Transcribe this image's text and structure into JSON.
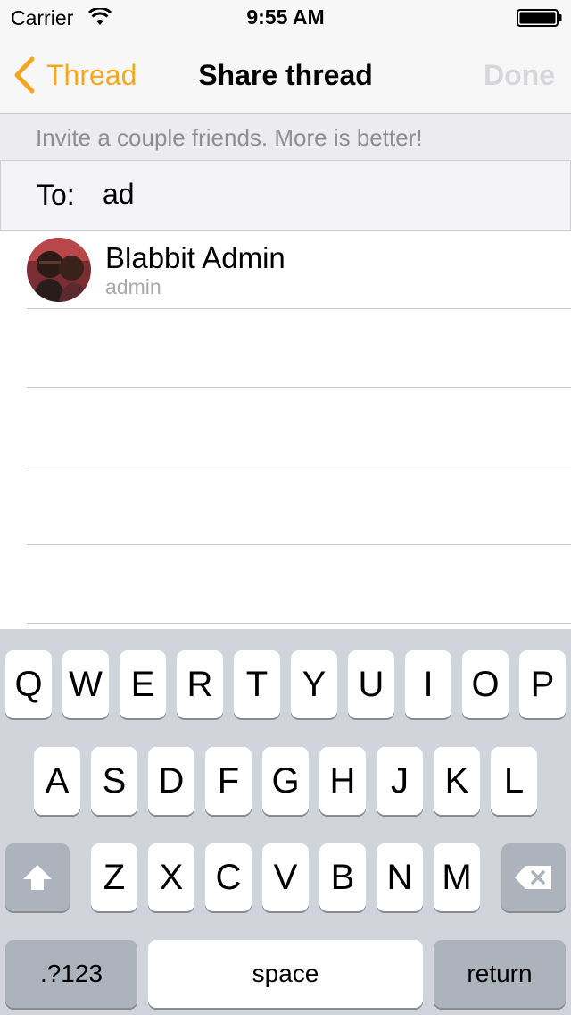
{
  "status_bar": {
    "carrier": "Carrier",
    "time": "9:55 AM",
    "wifi_icon": "wifi-icon",
    "battery_icon": "battery-icon"
  },
  "nav": {
    "back_label": "Thread",
    "back_icon": "chevron-left-icon",
    "title": "Share thread",
    "done_label": "Done",
    "accent_color": "#f5a623",
    "done_state": "disabled"
  },
  "hint": "Invite a couple friends. More is better!",
  "to_field": {
    "label": "To:",
    "value": "ad"
  },
  "results": [
    {
      "name": "Blabbit Admin",
      "username": "admin"
    }
  ],
  "keyboard": {
    "row1": [
      "Q",
      "W",
      "E",
      "R",
      "T",
      "Y",
      "U",
      "I",
      "O",
      "P"
    ],
    "row2": [
      "A",
      "S",
      "D",
      "F",
      "G",
      "H",
      "J",
      "K",
      "L"
    ],
    "row3": [
      "Z",
      "X",
      "C",
      "V",
      "B",
      "N",
      "M"
    ],
    "shift_icon": "shift-arrow-icon",
    "delete_icon": "backspace-icon",
    "numbers_label": ".?123",
    "space_label": "space",
    "return_label": "return"
  }
}
